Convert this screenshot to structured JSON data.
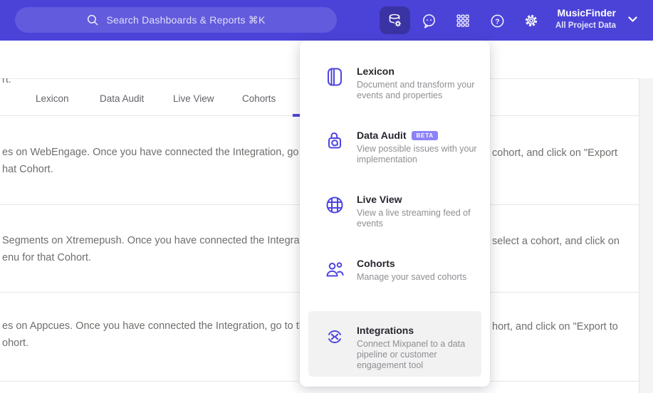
{
  "header": {
    "search_placeholder": "Search Dashboards & Reports ⌘K",
    "project_name": "MusicFinder",
    "project_subtitle": "All Project Data",
    "icons": [
      "data-settings-icon",
      "feedback-icon",
      "apps-grid-icon",
      "help-icon",
      "settings-gear-icon"
    ]
  },
  "tabs": [
    {
      "label": "Lexicon"
    },
    {
      "label": "Data Audit"
    },
    {
      "label": "Live View"
    },
    {
      "label": "Cohorts"
    }
  ],
  "menu": {
    "items": [
      {
        "title": "Lexicon",
        "icon": "book-icon",
        "description": "Document and transform your events and properties"
      },
      {
        "title": "Data Audit",
        "icon": "lock-audit-icon",
        "badge": "BETA",
        "description": "View possible issues with your implementation"
      },
      {
        "title": "Live View",
        "icon": "globe-icon",
        "description": "View a live streaming feed of events"
      },
      {
        "title": "Cohorts",
        "icon": "people-icon",
        "description": "Manage your saved cohorts"
      },
      {
        "title": "Integrations",
        "icon": "sync-arrows-icon",
        "description": "Connect Mixpanel to a data pipeline or customer engagement tool",
        "highlighted": true
      }
    ]
  },
  "background_fragments": [
    {
      "text": "rt."
    },
    {
      "text": "es on WebEngage. Once you have connected the Integration, go to the"
    },
    {
      "text": "hat Cohort."
    },
    {
      "text": "cohort, and click on \"Export"
    },
    {
      "text": "Segments on Xtremepush. Once you have connected the Integration, "
    },
    {
      "text": "enu for that Cohort."
    },
    {
      "text": "select a cohort, and click on"
    },
    {
      "text": "es on Appcues. Once you have connected the Integration, go to the M"
    },
    {
      "text": "ohort."
    },
    {
      "text": "hort, and click on \"Export to"
    }
  ],
  "colors": {
    "header_bg": "#4b43d8",
    "active_tile_bg": "#3a33a3",
    "accent": "#4f44e0",
    "badge_bg": "#8d82f6",
    "highlight_bg": "#f2f2f3",
    "body_text": "#716e6b",
    "menu_title": "#26262e",
    "menu_desc": "#8f8f94"
  }
}
